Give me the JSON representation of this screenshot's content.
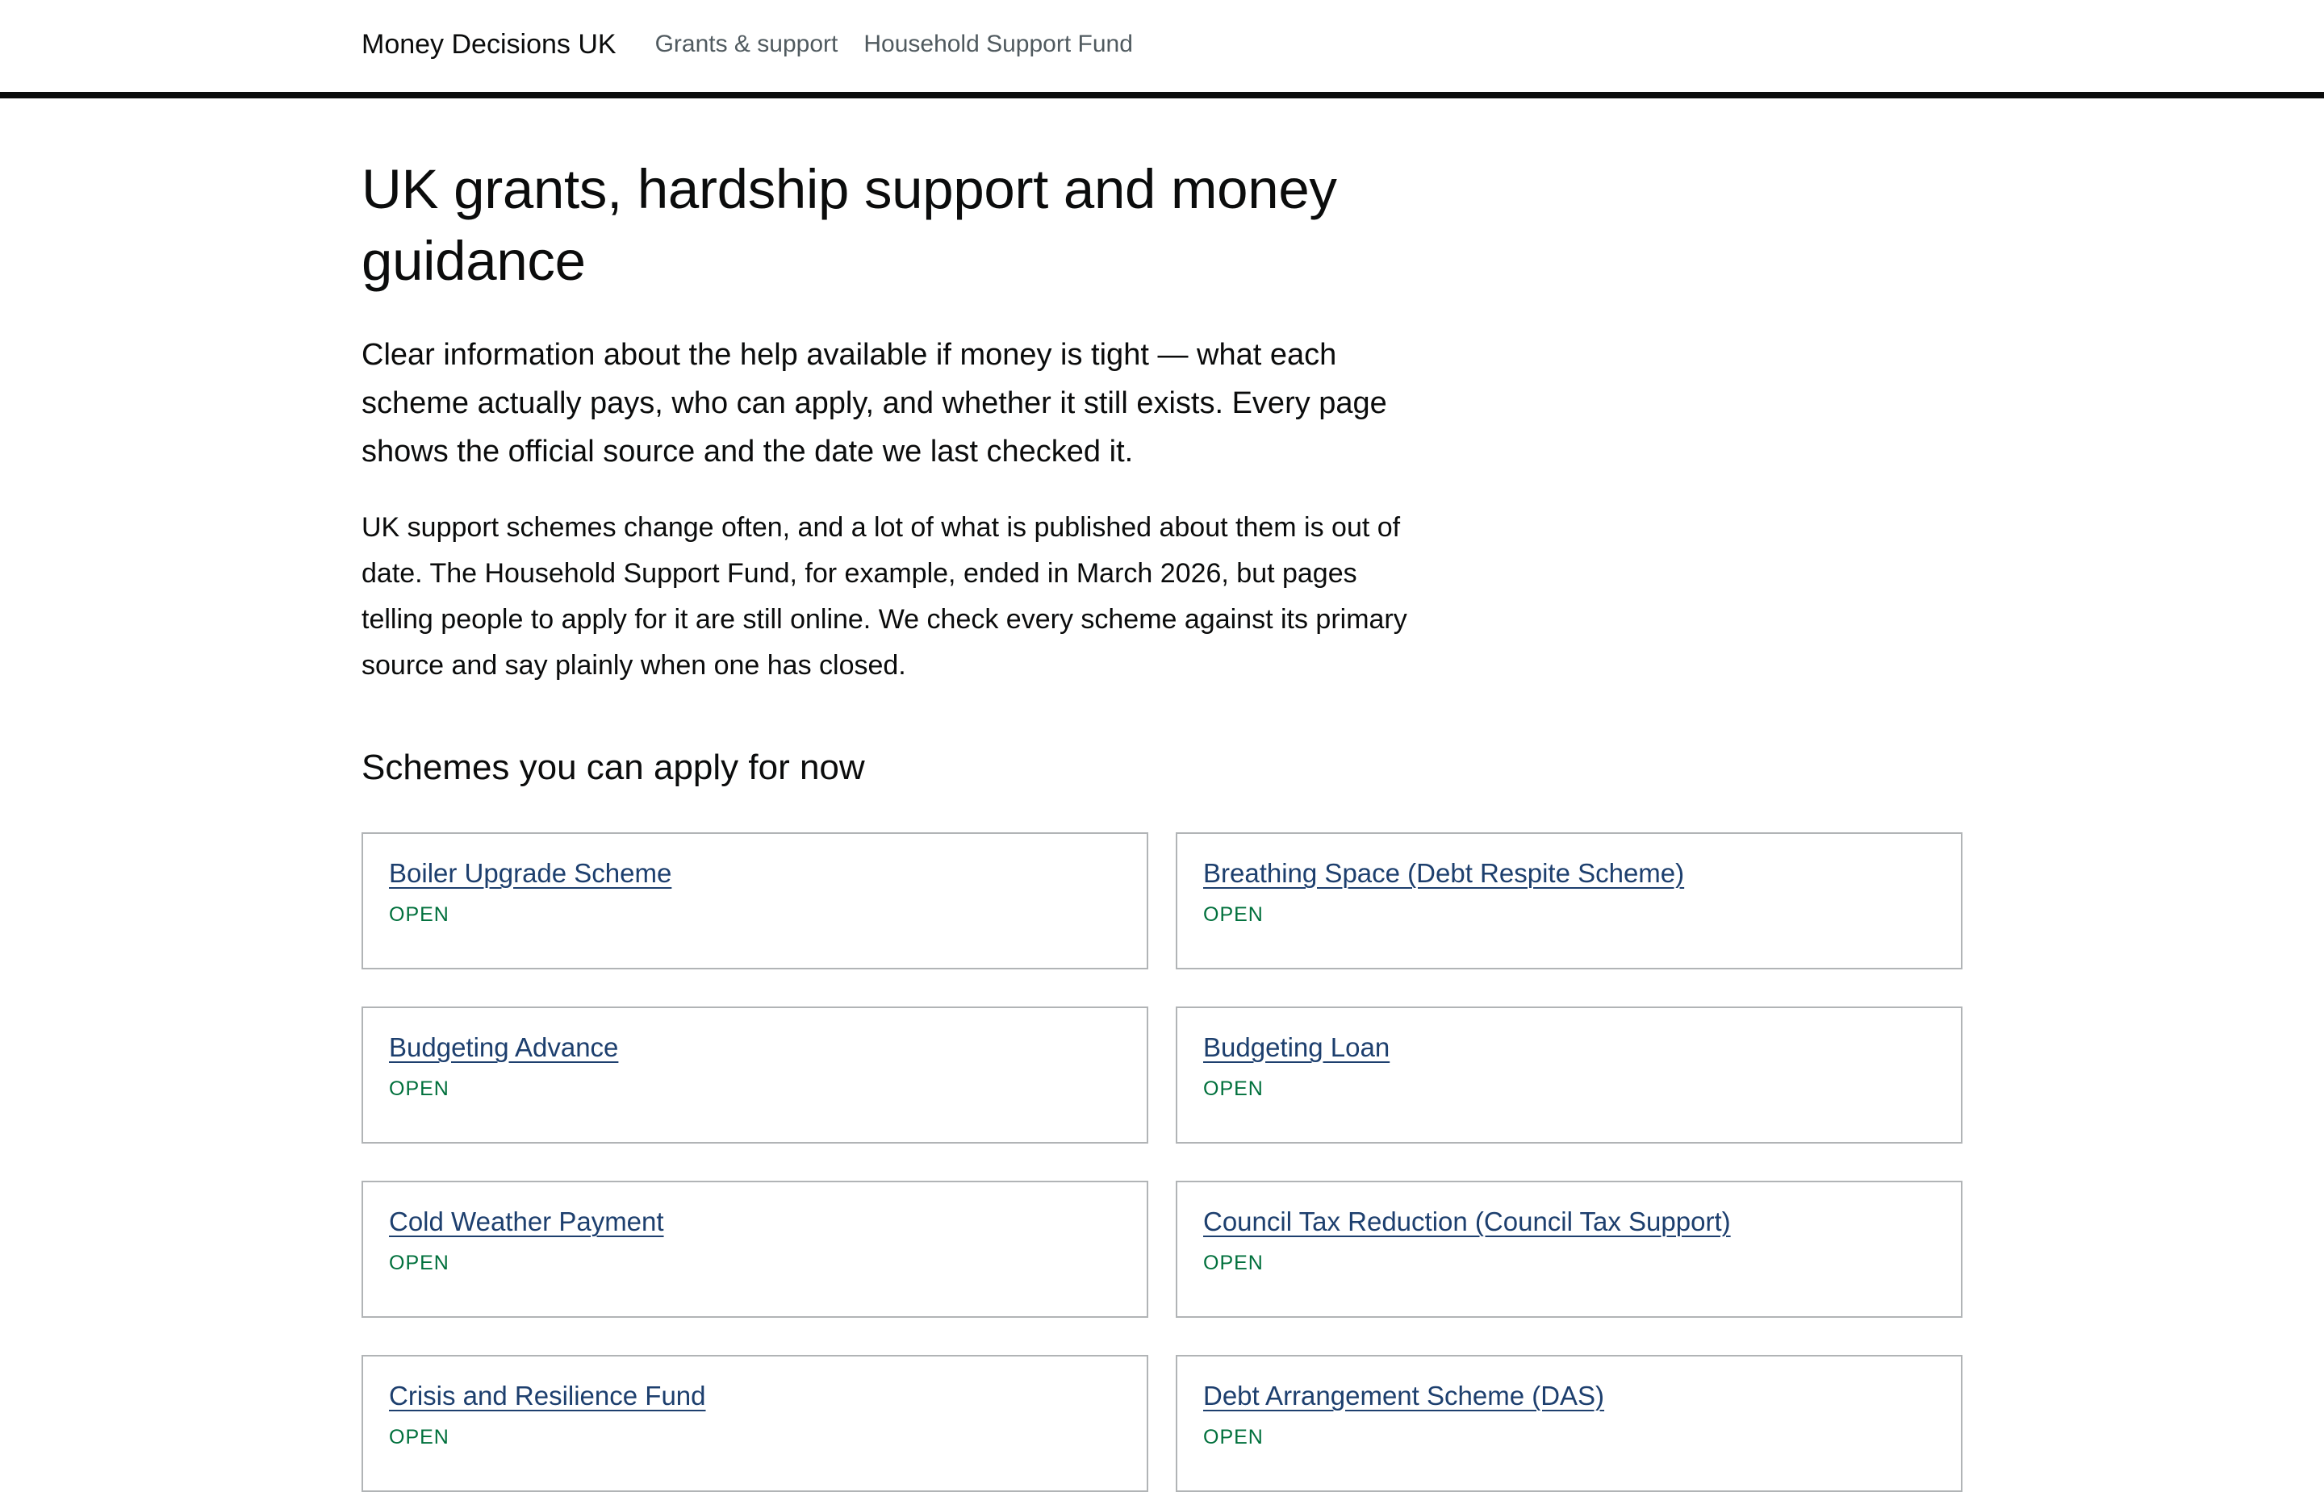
{
  "header": {
    "brand": "Money Decisions UK",
    "nav": [
      {
        "label": "Grants & support"
      },
      {
        "label": "Household Support Fund"
      }
    ]
  },
  "main": {
    "title": "UK grants, hardship support and money guidance",
    "lead": "Clear information about the help available if money is tight — what each scheme actually pays, who can apply, and whether it still exists. Every page shows the official source and the date we last checked it.",
    "body": "UK support schemes change often, and a lot of what is published about them is out of date. The Household Support Fund, for example, ended in March 2026, but pages telling people to apply for it are still online. We check every scheme against its primary source and say plainly when one has closed.",
    "section_title": "Schemes you can apply for now",
    "schemes": [
      {
        "name": "Boiler Upgrade Scheme",
        "status": "OPEN"
      },
      {
        "name": "Breathing Space (Debt Respite Scheme)",
        "status": "OPEN"
      },
      {
        "name": "Budgeting Advance",
        "status": "OPEN"
      },
      {
        "name": "Budgeting Loan",
        "status": "OPEN"
      },
      {
        "name": "Cold Weather Payment",
        "status": "OPEN"
      },
      {
        "name": "Council Tax Reduction (Council Tax Support)",
        "status": "OPEN"
      },
      {
        "name": "Crisis and Resilience Fund",
        "status": "OPEN"
      },
      {
        "name": "Debt Arrangement Scheme (DAS)",
        "status": "OPEN"
      }
    ]
  },
  "colors": {
    "text": "#0b0c0c",
    "link": "#1d3f6e",
    "status_open": "#00703c",
    "card_border": "#b1b4b6",
    "header_rule": "#0b0c0c"
  }
}
